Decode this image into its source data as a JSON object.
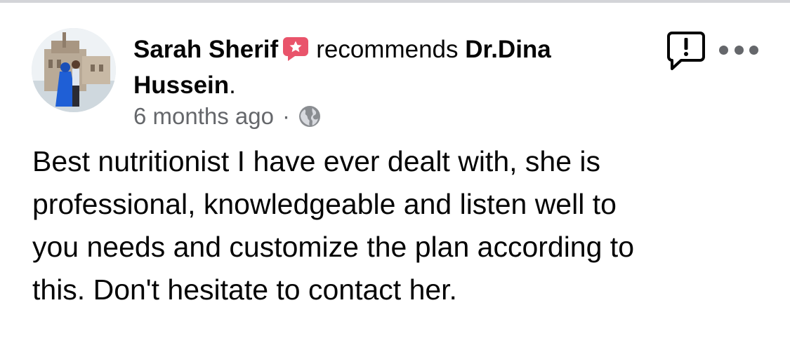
{
  "post": {
    "author": "Sarah Sherif",
    "action": "recommends",
    "target": "Dr.Dina Hussein",
    "target_suffix": ".",
    "timestamp": "6 months ago",
    "separator": "·",
    "audience_icon": "globe-icon",
    "badge_icon": "recommend-badge-icon",
    "report_icon": "report-icon",
    "more_icon": "more-dots-icon",
    "body_lines": [
      "Best nutritionist I have ever dealt with, she is",
      "professional, knowledgeable and listen well to",
      "you needs and customize the plan according to",
      "this. Don't hesitate to contact her."
    ]
  },
  "colors": {
    "text": "#050505",
    "secondary": "#65676b",
    "badge": "#e9546b",
    "divider": "#d3d4d8"
  }
}
